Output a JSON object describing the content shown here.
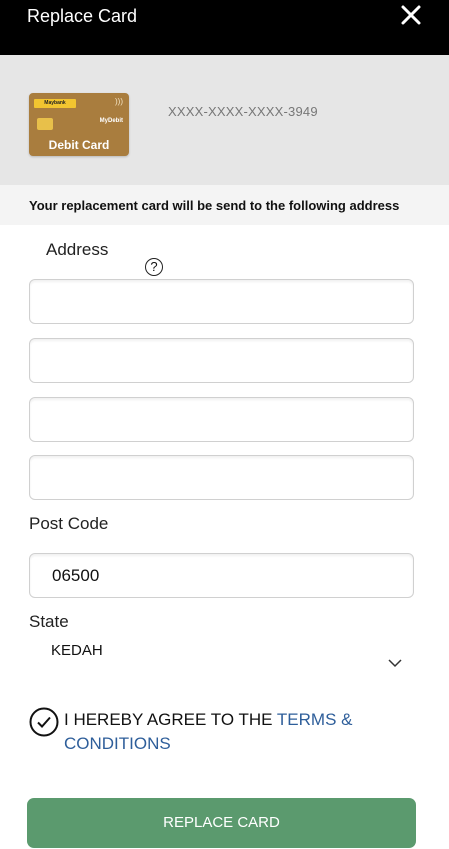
{
  "header": {
    "title": "Replace Card",
    "close_icon": "close-icon"
  },
  "card": {
    "bank_logo_text": "Maybank",
    "network_text": "MyDebit",
    "type_label": "Debit Card",
    "masked_number": "XXXX-XXXX-XXXX-3949"
  },
  "notice": "Your replacement card will be send to the following address",
  "form": {
    "address_label": "Address",
    "help_icon": "question-icon",
    "address_lines": [
      "",
      "",
      "",
      ""
    ],
    "postcode_label": "Post Code",
    "postcode_value": "06500",
    "state_label": "State",
    "state_value": "KEDAH"
  },
  "agreement": {
    "prefix": "I HEREBY AGREE TO THE ",
    "link": "TERMS & CONDITIONS"
  },
  "submit_label": "REPLACE CARD",
  "colors": {
    "header_bg": "#000000",
    "button": "#5b9a6e",
    "link": "#2e5e9a",
    "card": "#a97d3e"
  }
}
